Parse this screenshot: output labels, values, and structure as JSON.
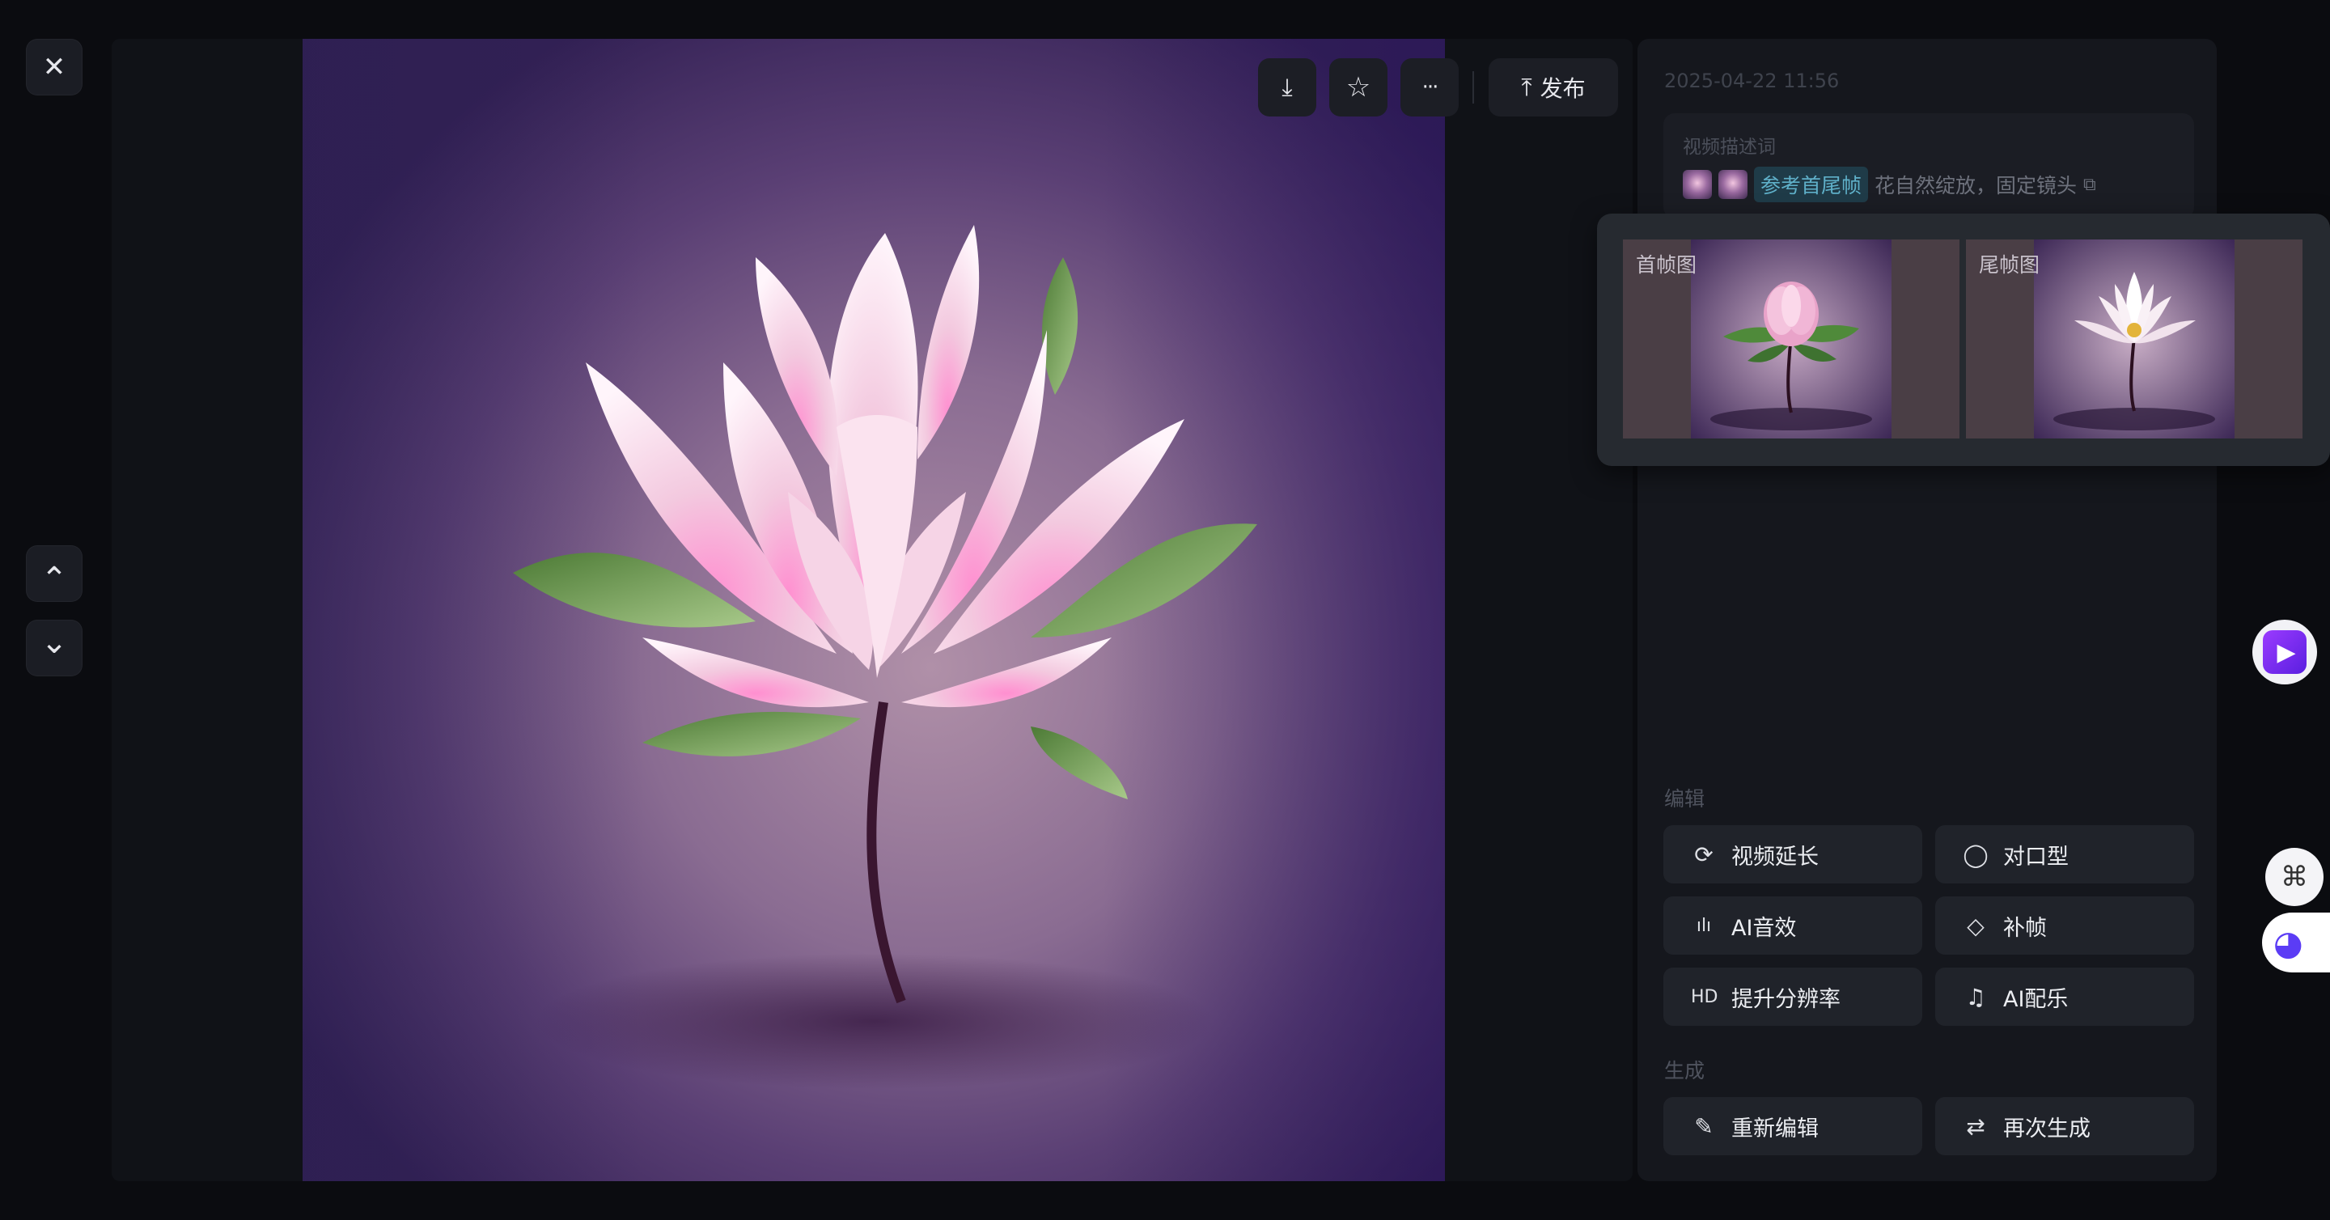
{
  "controls": {
    "close_icon": "✕",
    "up_icon": "⌃",
    "down_icon": "⌄"
  },
  "toolbar": {
    "download_icon": "⤓",
    "star_icon": "☆",
    "more_icon": "···",
    "publish_icon": "⤒",
    "publish_label": "发布"
  },
  "panel": {
    "timestamp": "2025-04-22 11:56",
    "prompt_label": "视频描述词",
    "ref_tag": "参考首尾帧",
    "prompt_text": "花自然绽放，固定镜头",
    "copy_icon": "⧉",
    "first_frame_label": "首帧图",
    "last_frame_label": "尾帧图",
    "edit_section": "编辑",
    "generate_section": "生成",
    "actions": {
      "video_extend": {
        "icon": "⟳",
        "label": "视频延长"
      },
      "lip_sync": {
        "icon": "◯",
        "label": "对口型"
      },
      "ai_sound": {
        "icon": "ılı",
        "label": "AI音效"
      },
      "frame_interp": {
        "icon": "◇",
        "label": "补帧"
      },
      "upscale": {
        "icon": "HD",
        "label": "提升分辨率"
      },
      "ai_music": {
        "icon": "♫",
        "label": "AI配乐"
      },
      "re_edit": {
        "icon": "✎",
        "label": "重新编辑"
      },
      "regenerate": {
        "icon": "⇄",
        "label": "再次生成"
      }
    }
  },
  "floating": {
    "play_icon": "▶",
    "grid_icon": "⌘",
    "bot_icon": "◕"
  },
  "colors": {
    "background": "#0b0c10",
    "panel": "#15171d",
    "button": "#20232a",
    "accent_tag": "#5fb0c9",
    "play_purple": "#7b2ff7"
  }
}
